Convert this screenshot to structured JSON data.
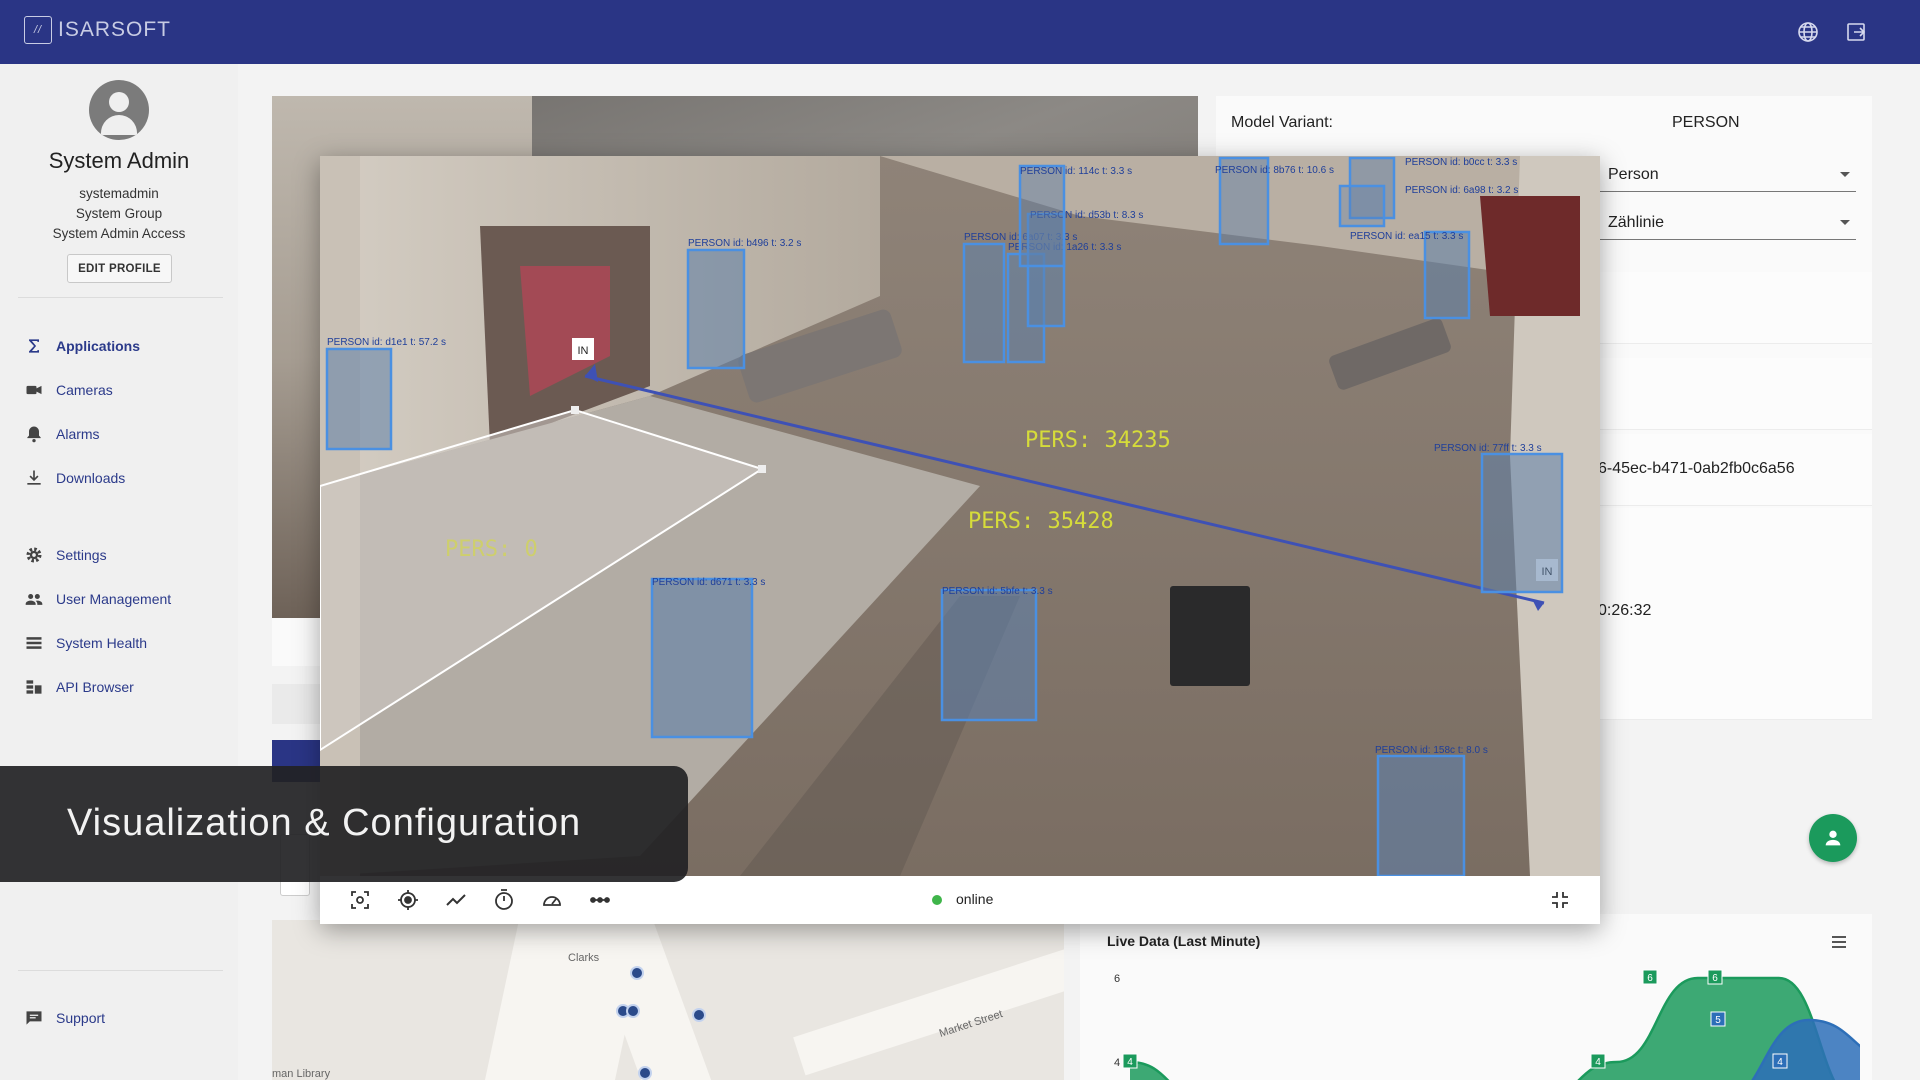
{
  "app": {
    "brand": "ISARSOFT",
    "colors": {
      "primary": "#2a3585",
      "success": "#1b9a5c",
      "online": "#3fb54a",
      "box": "#4a90e2",
      "line": "#3e51b5",
      "count_text": "#d6dc3a"
    }
  },
  "header": {
    "icons": [
      "globe-icon",
      "logout-icon"
    ]
  },
  "sidebar": {
    "user": {
      "name": "System Admin",
      "username": "systemadmin",
      "group": "System Group",
      "access": "System Admin Access",
      "edit_label": "EDIT PROFILE"
    },
    "items": [
      {
        "label": "Applications",
        "icon": "sigma-icon"
      },
      {
        "label": "Cameras",
        "icon": "camera-icon"
      },
      {
        "label": "Alarms",
        "icon": "bell-icon"
      },
      {
        "label": "Downloads",
        "icon": "download-icon"
      },
      {
        "label": "Settings",
        "icon": "gear-icon"
      },
      {
        "label": "User Management",
        "icon": "people-icon"
      },
      {
        "label": "System Health",
        "icon": "list-icon"
      },
      {
        "label": "API Browser",
        "icon": "api-icon"
      },
      {
        "label": "Support",
        "icon": "chat-icon"
      }
    ]
  },
  "details": {
    "model_label": "Model Variant:",
    "model_value": "PERSON",
    "class_select": "Person",
    "type_select": "Zählinie",
    "uuid_partial": "6-45ec-b471-0ab2fb0c6a56",
    "time_partial": "0:26:32"
  },
  "map": {
    "labels": [
      "Clarks",
      "Market Street",
      "man Library"
    ]
  },
  "live_chart": {
    "title": "Live Data (Last Minute)"
  },
  "chart_data": {
    "type": "area",
    "title": "Live Data (Last Minute)",
    "ytick_labels": [
      "6",
      "4"
    ],
    "series": [
      {
        "values": [
          4,
          3,
          3,
          3,
          3,
          3,
          4,
          6,
          6,
          3
        ]
      },
      {
        "values": [
          3,
          3,
          3,
          3,
          3,
          3,
          3,
          5,
          4
        ]
      }
    ],
    "data_labels": [
      "4",
      "6",
      "6",
      "5",
      "4",
      "4"
    ]
  },
  "viewer": {
    "detections": [
      "PERSON id: d1e1 t: 57.2 s",
      "PERSON id: b496 t: 3.2 s",
      "PERSON id: 6a07 t: 3.3 s",
      "PERSON id: 1a26 t: 3.3 s",
      "PERSON id: d53b t: 8.3 s",
      "PERSON id: 114c t: 3.3 s",
      "PERSON id: 8b76 t: 10.6 s",
      "PERSON id: b0cc t: 3.3 s",
      "PERSON id: 6a98 t: 3.2 s",
      "PERSON id: ea15 t: 3.3 s",
      "PERSON id: 77ff t: 3.3 s",
      "PERSON id: d671 t: 3.3 s",
      "PERSON id: 5bfe t: 3.3 s",
      "PERSON id: 158c t: 8.0 s"
    ],
    "counter_big": "PERS: 34235",
    "counter_mid": "PERS: 35428",
    "counter_zone": "PERS: 0",
    "line_tag_a": "IN",
    "line_tag_b": "IN",
    "status": "online",
    "toolbar_icons": [
      "focus-icon",
      "target-icon",
      "trend-icon",
      "timer-icon",
      "speed-icon",
      "line-tool-icon",
      "exit-fullscreen-icon"
    ]
  },
  "caption": {
    "text": "Visualization & Configuration"
  }
}
